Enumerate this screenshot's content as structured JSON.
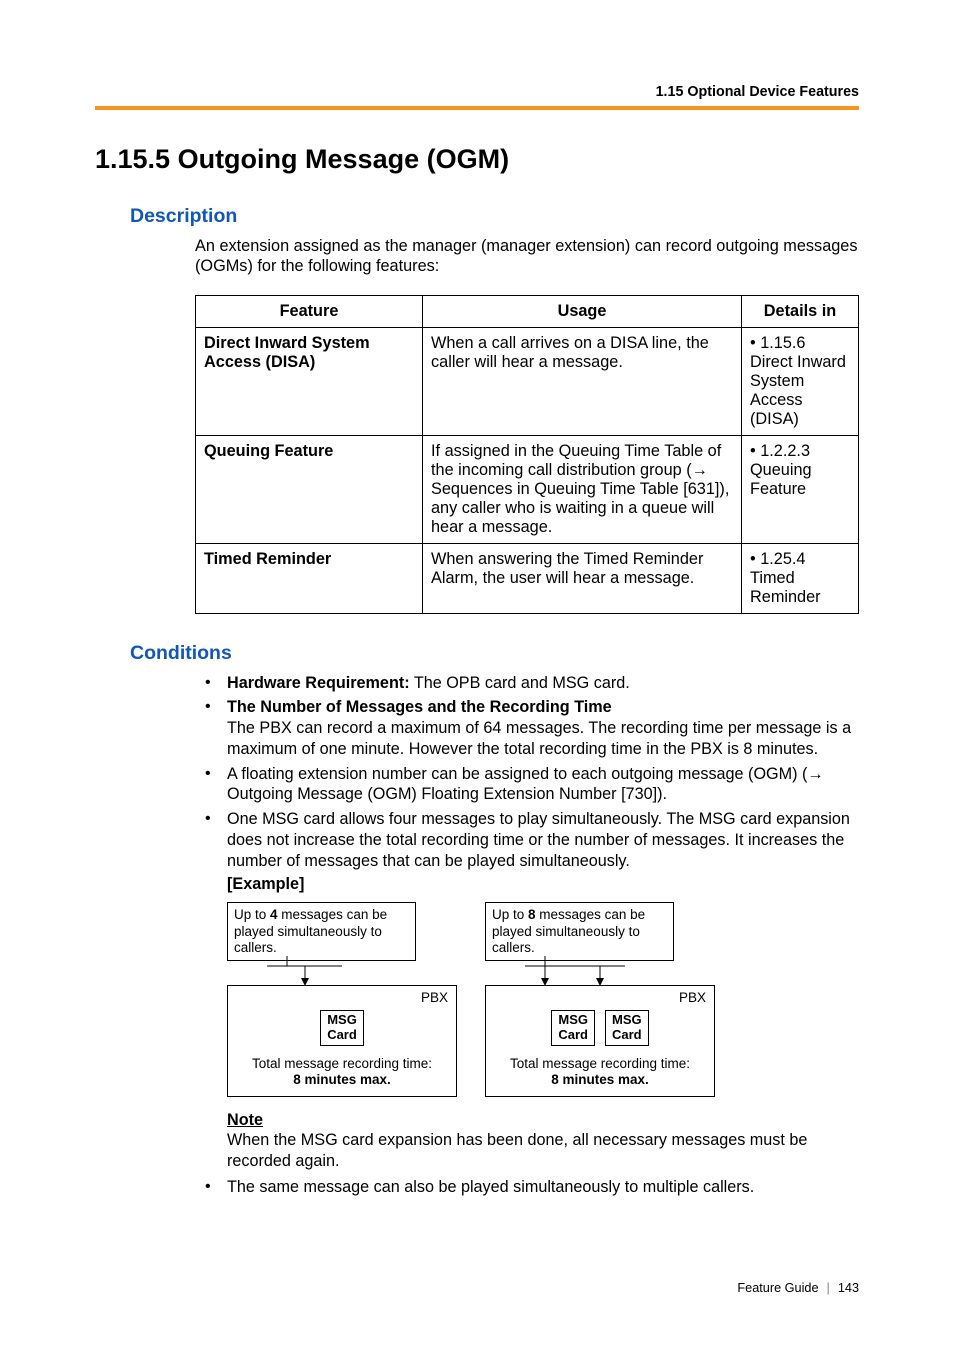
{
  "running_head": "1.15 Optional Device Features",
  "title": "1.15.5  Outgoing Message (OGM)",
  "description_heading": "Description",
  "description_body": "An extension assigned as the manager (manager extension) can record outgoing messages (OGMs) for the following features:",
  "table": {
    "headers": [
      "Feature",
      "Usage",
      "Details in"
    ],
    "rows": [
      {
        "feature": "Direct Inward System Access (DISA)",
        "usage": "When a call arrives on a DISA line, the caller will hear a message.",
        "details": "• 1.15.6 Direct Inward System Access (DISA)"
      },
      {
        "feature": "Queuing Feature",
        "usage_pre": "If assigned in the Queuing Time Table of the incoming call distribution group (",
        "usage_post": " Sequences in Queuing Time Table [631]), any caller who is waiting in a queue will hear a message.",
        "details": "• 1.2.2.3 Queuing Feature"
      },
      {
        "feature": "Timed Reminder",
        "usage": "When answering the Timed Reminder Alarm, the user will hear a message.",
        "details": "• 1.25.4 Timed Reminder"
      }
    ]
  },
  "conditions_heading": "Conditions",
  "conditions": [
    {
      "lead": "Hardware Requirement:",
      "rest": " The OPB card and MSG card."
    },
    {
      "lead": "The Number of Messages and the Recording Time",
      "body": "The PBX can record a maximum of 64 messages. The recording time per message is a maximum of one minute. However the total recording time in the PBX is 8 minutes."
    },
    {
      "text_pre": "A floating extension number can be assigned to each outgoing message (OGM) (",
      "text_post": " Outgoing Message (OGM) Floating Extension Number [730])."
    },
    {
      "text": "One MSG card allows four messages to play simultaneously. The MSG card expansion does not increase the total recording time or the number of messages. It increases the number of messages that can be played simultaneously."
    }
  ],
  "example_label": "[Example]",
  "diagram": {
    "left_callout_pre": "Up to ",
    "left_callout_bold": "4",
    "callout_post": " messages can be played simultaneously to callers.",
    "right_callout_pre": "Up to ",
    "right_callout_bold": "8",
    "pbx_label": "PBX",
    "msg_card_l1": "MSG",
    "msg_card_l2": "Card",
    "rec_line1": "Total message recording time:",
    "rec_line2": "8 minutes max."
  },
  "note_label": "Note",
  "note_body": "When the MSG card expansion has been done, all necessary messages must be recorded again.",
  "last_bullet": "The same message can also be played simultaneously to multiple callers.",
  "footer_guide": "Feature Guide",
  "footer_page": "143"
}
